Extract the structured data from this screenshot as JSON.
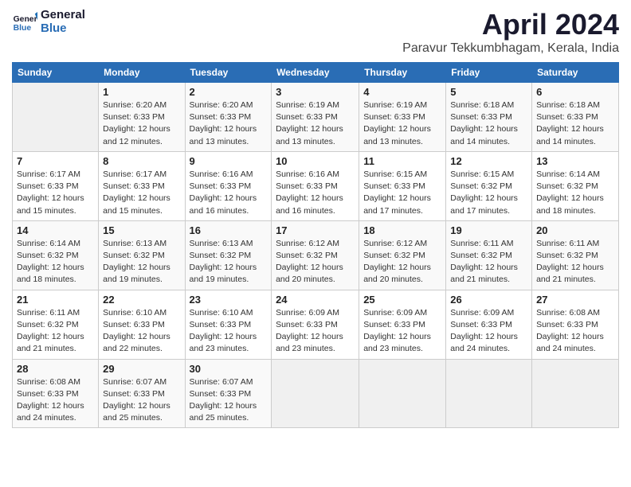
{
  "logo": {
    "general": "General",
    "blue": "Blue"
  },
  "title": "April 2024",
  "location": "Paravur Tekkumbhagam, Kerala, India",
  "days_of_week": [
    "Sunday",
    "Monday",
    "Tuesday",
    "Wednesday",
    "Thursday",
    "Friday",
    "Saturday"
  ],
  "weeks": [
    [
      {
        "day": "",
        "info": ""
      },
      {
        "day": "1",
        "info": "Sunrise: 6:20 AM\nSunset: 6:33 PM\nDaylight: 12 hours\nand 12 minutes."
      },
      {
        "day": "2",
        "info": "Sunrise: 6:20 AM\nSunset: 6:33 PM\nDaylight: 12 hours\nand 13 minutes."
      },
      {
        "day": "3",
        "info": "Sunrise: 6:19 AM\nSunset: 6:33 PM\nDaylight: 12 hours\nand 13 minutes."
      },
      {
        "day": "4",
        "info": "Sunrise: 6:19 AM\nSunset: 6:33 PM\nDaylight: 12 hours\nand 13 minutes."
      },
      {
        "day": "5",
        "info": "Sunrise: 6:18 AM\nSunset: 6:33 PM\nDaylight: 12 hours\nand 14 minutes."
      },
      {
        "day": "6",
        "info": "Sunrise: 6:18 AM\nSunset: 6:33 PM\nDaylight: 12 hours\nand 14 minutes."
      }
    ],
    [
      {
        "day": "7",
        "info": ""
      },
      {
        "day": "8",
        "info": "Sunrise: 6:17 AM\nSunset: 6:33 PM\nDaylight: 12 hours\nand 15 minutes."
      },
      {
        "day": "9",
        "info": "Sunrise: 6:16 AM\nSunset: 6:33 PM\nDaylight: 12 hours\nand 16 minutes."
      },
      {
        "day": "10",
        "info": "Sunrise: 6:16 AM\nSunset: 6:33 PM\nDaylight: 12 hours\nand 16 minutes."
      },
      {
        "day": "11",
        "info": "Sunrise: 6:15 AM\nSunset: 6:33 PM\nDaylight: 12 hours\nand 17 minutes."
      },
      {
        "day": "12",
        "info": "Sunrise: 6:15 AM\nSunset: 6:32 PM\nDaylight: 12 hours\nand 17 minutes."
      },
      {
        "day": "13",
        "info": "Sunrise: 6:14 AM\nSunset: 6:32 PM\nDaylight: 12 hours\nand 18 minutes."
      }
    ],
    [
      {
        "day": "14",
        "info": ""
      },
      {
        "day": "15",
        "info": "Sunrise: 6:13 AM\nSunset: 6:32 PM\nDaylight: 12 hours\nand 19 minutes."
      },
      {
        "day": "16",
        "info": "Sunrise: 6:13 AM\nSunset: 6:32 PM\nDaylight: 12 hours\nand 19 minutes."
      },
      {
        "day": "17",
        "info": "Sunrise: 6:12 AM\nSunset: 6:32 PM\nDaylight: 12 hours\nand 20 minutes."
      },
      {
        "day": "18",
        "info": "Sunrise: 6:12 AM\nSunset: 6:32 PM\nDaylight: 12 hours\nand 20 minutes."
      },
      {
        "day": "19",
        "info": "Sunrise: 6:11 AM\nSunset: 6:32 PM\nDaylight: 12 hours\nand 21 minutes."
      },
      {
        "day": "20",
        "info": "Sunrise: 6:11 AM\nSunset: 6:32 PM\nDaylight: 12 hours\nand 21 minutes."
      }
    ],
    [
      {
        "day": "21",
        "info": ""
      },
      {
        "day": "22",
        "info": "Sunrise: 6:10 AM\nSunset: 6:33 PM\nDaylight: 12 hours\nand 22 minutes."
      },
      {
        "day": "23",
        "info": "Sunrise: 6:10 AM\nSunset: 6:33 PM\nDaylight: 12 hours\nand 23 minutes."
      },
      {
        "day": "24",
        "info": "Sunrise: 6:09 AM\nSunset: 6:33 PM\nDaylight: 12 hours\nand 23 minutes."
      },
      {
        "day": "25",
        "info": "Sunrise: 6:09 AM\nSunset: 6:33 PM\nDaylight: 12 hours\nand 23 minutes."
      },
      {
        "day": "26",
        "info": "Sunrise: 6:09 AM\nSunset: 6:33 PM\nDaylight: 12 hours\nand 24 minutes."
      },
      {
        "day": "27",
        "info": "Sunrise: 6:08 AM\nSunset: 6:33 PM\nDaylight: 12 hours\nand 24 minutes."
      }
    ],
    [
      {
        "day": "28",
        "info": "Sunrise: 6:08 AM\nSunset: 6:33 PM\nDaylight: 12 hours\nand 24 minutes."
      },
      {
        "day": "29",
        "info": "Sunrise: 6:07 AM\nSunset: 6:33 PM\nDaylight: 12 hours\nand 25 minutes."
      },
      {
        "day": "30",
        "info": "Sunrise: 6:07 AM\nSunset: 6:33 PM\nDaylight: 12 hours\nand 25 minutes."
      },
      {
        "day": "",
        "info": ""
      },
      {
        "day": "",
        "info": ""
      },
      {
        "day": "",
        "info": ""
      },
      {
        "day": "",
        "info": ""
      }
    ]
  ],
  "week7_day7_info": "Sunrise: 6:17 AM\nSunset: 6:33 PM\nDaylight: 12 hours\nand 15 minutes.",
  "week14_info": "Sunrise: 6:14 AM\nSunset: 6:32 PM\nDaylight: 12 hours\nand 18 minutes.",
  "week21_info": "Sunrise: 6:11 AM\nSunset: 6:32 PM\nDaylight: 12 hours\nand 21 minutes."
}
